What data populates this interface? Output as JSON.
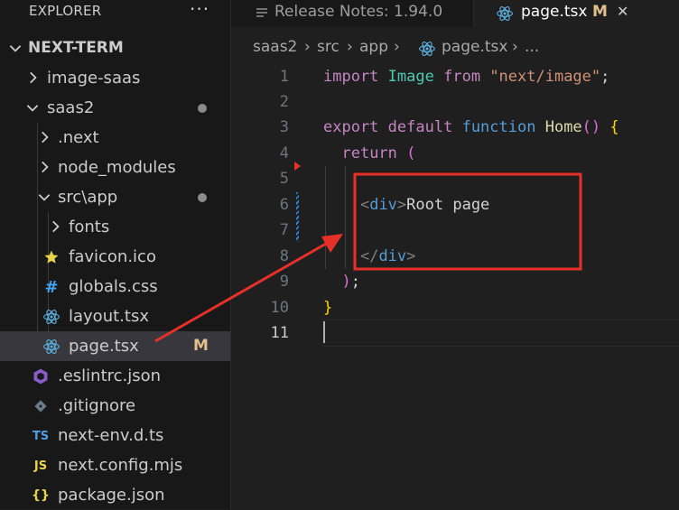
{
  "explorer": {
    "title": "EXPLORER",
    "more": "···",
    "root": "NEXT-TERM",
    "items": [
      {
        "label": "image-saas"
      },
      {
        "label": "saas2"
      },
      {
        "label": ".next"
      },
      {
        "label": "node_modules"
      },
      {
        "label": "src\\app"
      },
      {
        "label": "fonts"
      },
      {
        "label": "favicon.ico"
      },
      {
        "label": "globals.css"
      },
      {
        "label": "layout.tsx"
      },
      {
        "label": "page.tsx",
        "badge": "M"
      },
      {
        "label": ".eslintrc.json"
      },
      {
        "label": ".gitignore"
      },
      {
        "label": "next-env.d.ts",
        "icon_text": "TS"
      },
      {
        "label": "next.config.mjs",
        "icon_text": "JS"
      },
      {
        "label": "package.json",
        "icon_text": "{}"
      }
    ]
  },
  "tabs": [
    {
      "label": "Release Notes: 1.94.0"
    },
    {
      "label": "page.tsx",
      "badge": "M",
      "close": "✕"
    }
  ],
  "breadcrumbs": [
    "saas2",
    "src",
    "app",
    "page.tsx",
    "..."
  ],
  "editor": {
    "line_numbers": [
      "1",
      "2",
      "3",
      "4",
      "5",
      "6",
      "7",
      "8",
      "9",
      "10",
      "11"
    ],
    "lines": {
      "l1": {
        "import": "import",
        "ident": "Image",
        "from": "from",
        "str": "\"next/image\"",
        "semi": ";"
      },
      "l3": {
        "export": "export",
        "default": "default",
        "function": "function",
        "name": "Home",
        "open": "()",
        "brace": "{"
      },
      "l4": {
        "return": "return",
        "paren": "("
      },
      "l6": {
        "lt": "<",
        "tag": "div",
        "gt": ">",
        "text": "Root page"
      },
      "l8": {
        "lt": "</",
        "tag": "div",
        "gt": ">"
      },
      "l9": {
        "paren": ")",
        "semi": ";"
      },
      "l10": {
        "brace": "}"
      }
    }
  },
  "colors": {
    "annotation": "#e8302a",
    "modified": "#e2c08d"
  }
}
